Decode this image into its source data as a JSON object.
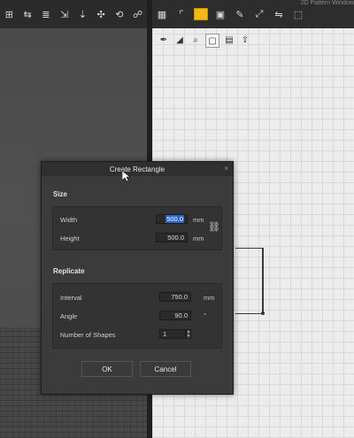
{
  "dialog": {
    "title": "Create Rectangle",
    "close": "×",
    "size_section": "Size",
    "width_label": "Width",
    "width_value": "500.0",
    "width_unit": "mm",
    "height_label": "Height",
    "height_value": "500.0",
    "height_unit": "mm",
    "replicate_section": "Replicate",
    "interval_label": "Interval",
    "interval_value": "750.0",
    "interval_unit": "mm",
    "angle_label": "Angle",
    "angle_value": "90.0",
    "angle_unit": "°",
    "shapes_label": "Number of Shapes",
    "shapes_value": "1",
    "ok_label": "OK",
    "cancel_label": "Cancel"
  },
  "toolbar_icons": [
    "view-icon",
    "align-icon",
    "stack-icon",
    "move-icon",
    "move-icon",
    "split-icon",
    "rotate-icon",
    "person-icon"
  ],
  "right_toolbar_icons": [
    "grid-icon",
    "frame-icon",
    "rectangle-icon",
    "image-icon",
    "paint-icon",
    "transform-icon",
    "flip-icon",
    "box-icon"
  ],
  "window_hint": "2D Pattern Window",
  "accent_color": "#f2b81a"
}
